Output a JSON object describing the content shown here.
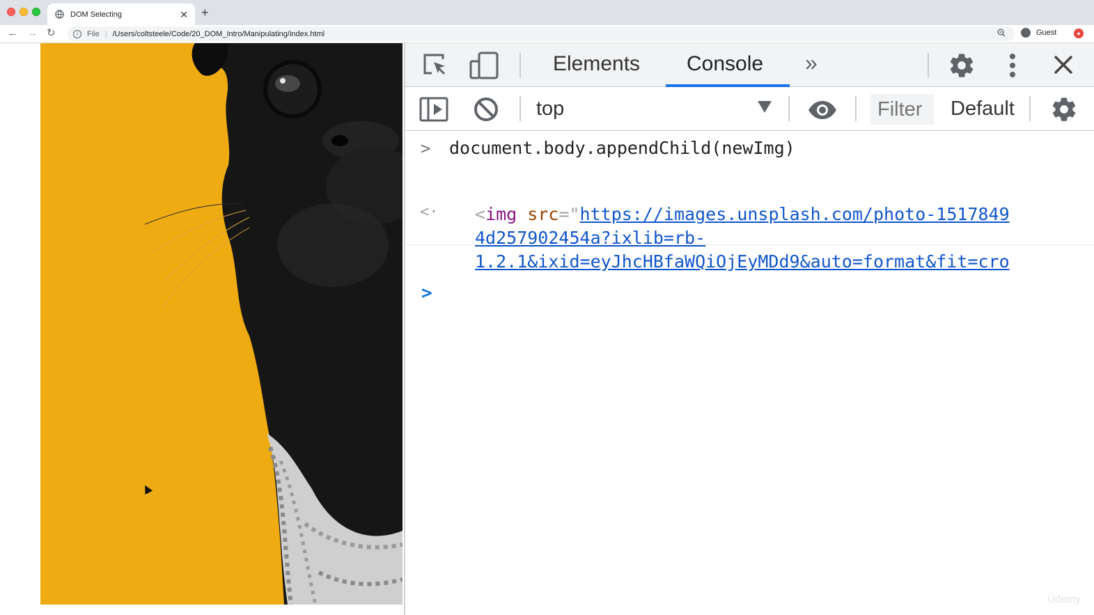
{
  "browser": {
    "tab_title": "DOM Selecting",
    "new_tab": "+",
    "close_tab": "✕",
    "url_scheme": "File",
    "url": "/Users/coltsteele/Code/20_DOM_Intro/Manipulating/index.html",
    "profile_name": "Guest"
  },
  "devtools": {
    "tabs": [
      {
        "label": "Elements",
        "active": false
      },
      {
        "label": "Console",
        "active": true
      }
    ],
    "more_tabs": "»",
    "context": "top",
    "filter_placeholder": "Filter",
    "levels": "Default levels",
    "accent_color": "#1a73e8"
  },
  "console": {
    "input": "document.body.appendChild(newImg)",
    "output": {
      "tag_open": "<",
      "tag_name": "img",
      "attr_name": "src",
      "attr_eq": "=\"",
      "url_line1": "https://images.unsplash.com/photo-1517849",
      "url_line2": "4d257902454a?ixlib=rb-",
      "url_line3": "1.2.1&ixid=eyJhcHBfaWQiOjEyMDd9&auto=format&fit=cro"
    }
  },
  "page": {
    "image_alt": "pug on yellow background",
    "background_color": "#eeab12"
  },
  "watermark": "Ûdemy"
}
